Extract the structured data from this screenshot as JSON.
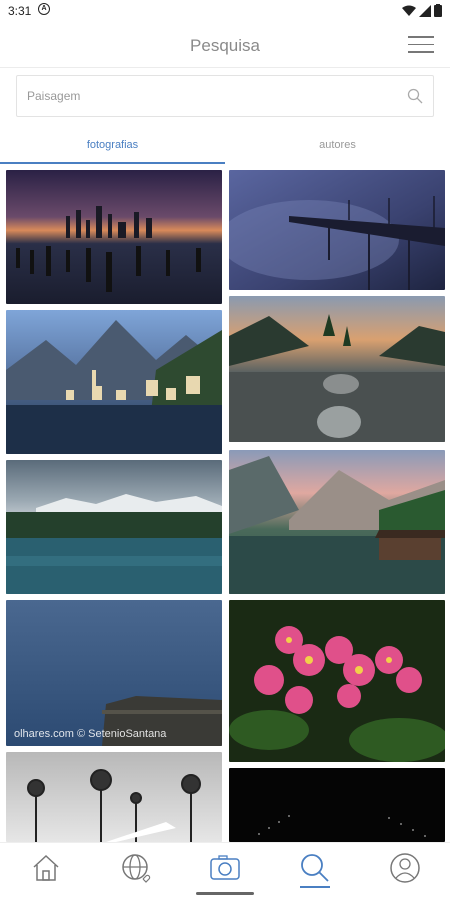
{
  "status": {
    "time": "3:31",
    "notif_icon": "A"
  },
  "header": {
    "title": "Pesquisa",
    "menu_icon": "menu-icon"
  },
  "search": {
    "placeholder": "Paisagem",
    "value": "",
    "icon": "search-icon"
  },
  "tabs": [
    {
      "label": "fotografias",
      "active": true
    },
    {
      "label": "autores",
      "active": false
    }
  ],
  "photos": [
    {
      "subject": "city skyline pier sunset"
    },
    {
      "subject": "railway bridge in fog"
    },
    {
      "subject": "lakeside village in mountains"
    },
    {
      "subject": "rocky lake with trees at sunrise"
    },
    {
      "subject": "forest lake with mountains"
    },
    {
      "subject": "alpine lake with boathouse"
    },
    {
      "subject": "sea coast with rocks",
      "watermark": "olhares.com © SetenioSantana"
    },
    {
      "subject": "pink begonia flowers"
    },
    {
      "subject": "black and white park trees"
    },
    {
      "subject": "night sky"
    }
  ],
  "bottom_nav": [
    {
      "name": "home-icon",
      "active": false
    },
    {
      "name": "globe-icon",
      "active": false
    },
    {
      "name": "camera-icon",
      "active": false
    },
    {
      "name": "search-icon",
      "active": true
    },
    {
      "name": "user-icon",
      "active": false
    }
  ],
  "colors": {
    "accent": "#4a7fc2",
    "title": "#8a8a8a"
  }
}
